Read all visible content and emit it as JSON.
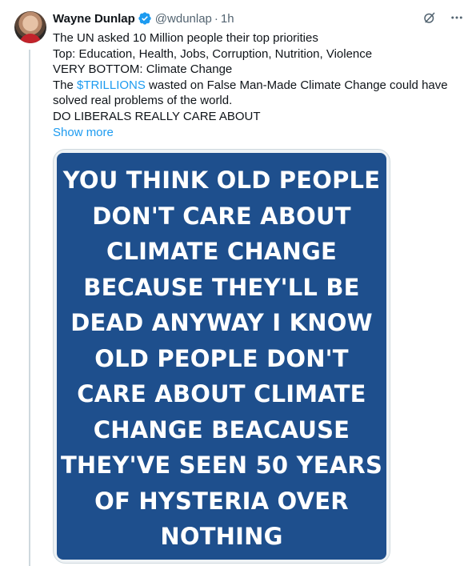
{
  "author": {
    "name": "Wayne Dunlap",
    "handle": "@wdunlap",
    "separator": "·",
    "time": "1h"
  },
  "icons": {
    "avatar": "profile-photo",
    "verified": "verified-badge-icon",
    "grok": "grok-icon",
    "more": "more-icon"
  },
  "colors": {
    "link": "#1d9bf0",
    "verified": "#1d9bf0",
    "poster_bg": "#1e4f8d",
    "text": "#0f1419",
    "muted": "#536471"
  },
  "post": {
    "line1": "The UN asked 10 Million people their top priorities",
    "line2": "Top: Education, Health, Jobs, Corruption, Nutrition, Violence",
    "line3": "VERY BOTTOM: Climate Change",
    "line4_prefix": "The ",
    "line4_cashtag": "$TRILLIONS",
    "line4_suffix": " wasted on False Man-Made Climate Change could have",
    "line5": "solved real problems of the world.",
    "line6": "DO LIBERALS REALLY CARE ABOUT",
    "show_more": "Show more"
  },
  "media": {
    "lines": [
      "YOU THINK OLD PEOPLE",
      "DON'T CARE ABOUT",
      "CLIMATE CHANGE",
      "BECAUSE THEY'LL BE",
      "DEAD ANYWAY I KNOW",
      "OLD PEOPLE DON'T",
      "CARE ABOUT CLIMATE",
      "CHANGE BEACAUSE",
      "THEY'VE SEEN 50 YEARS",
      "OF HYSTERIA OVER",
      "NOTHING"
    ]
  }
}
